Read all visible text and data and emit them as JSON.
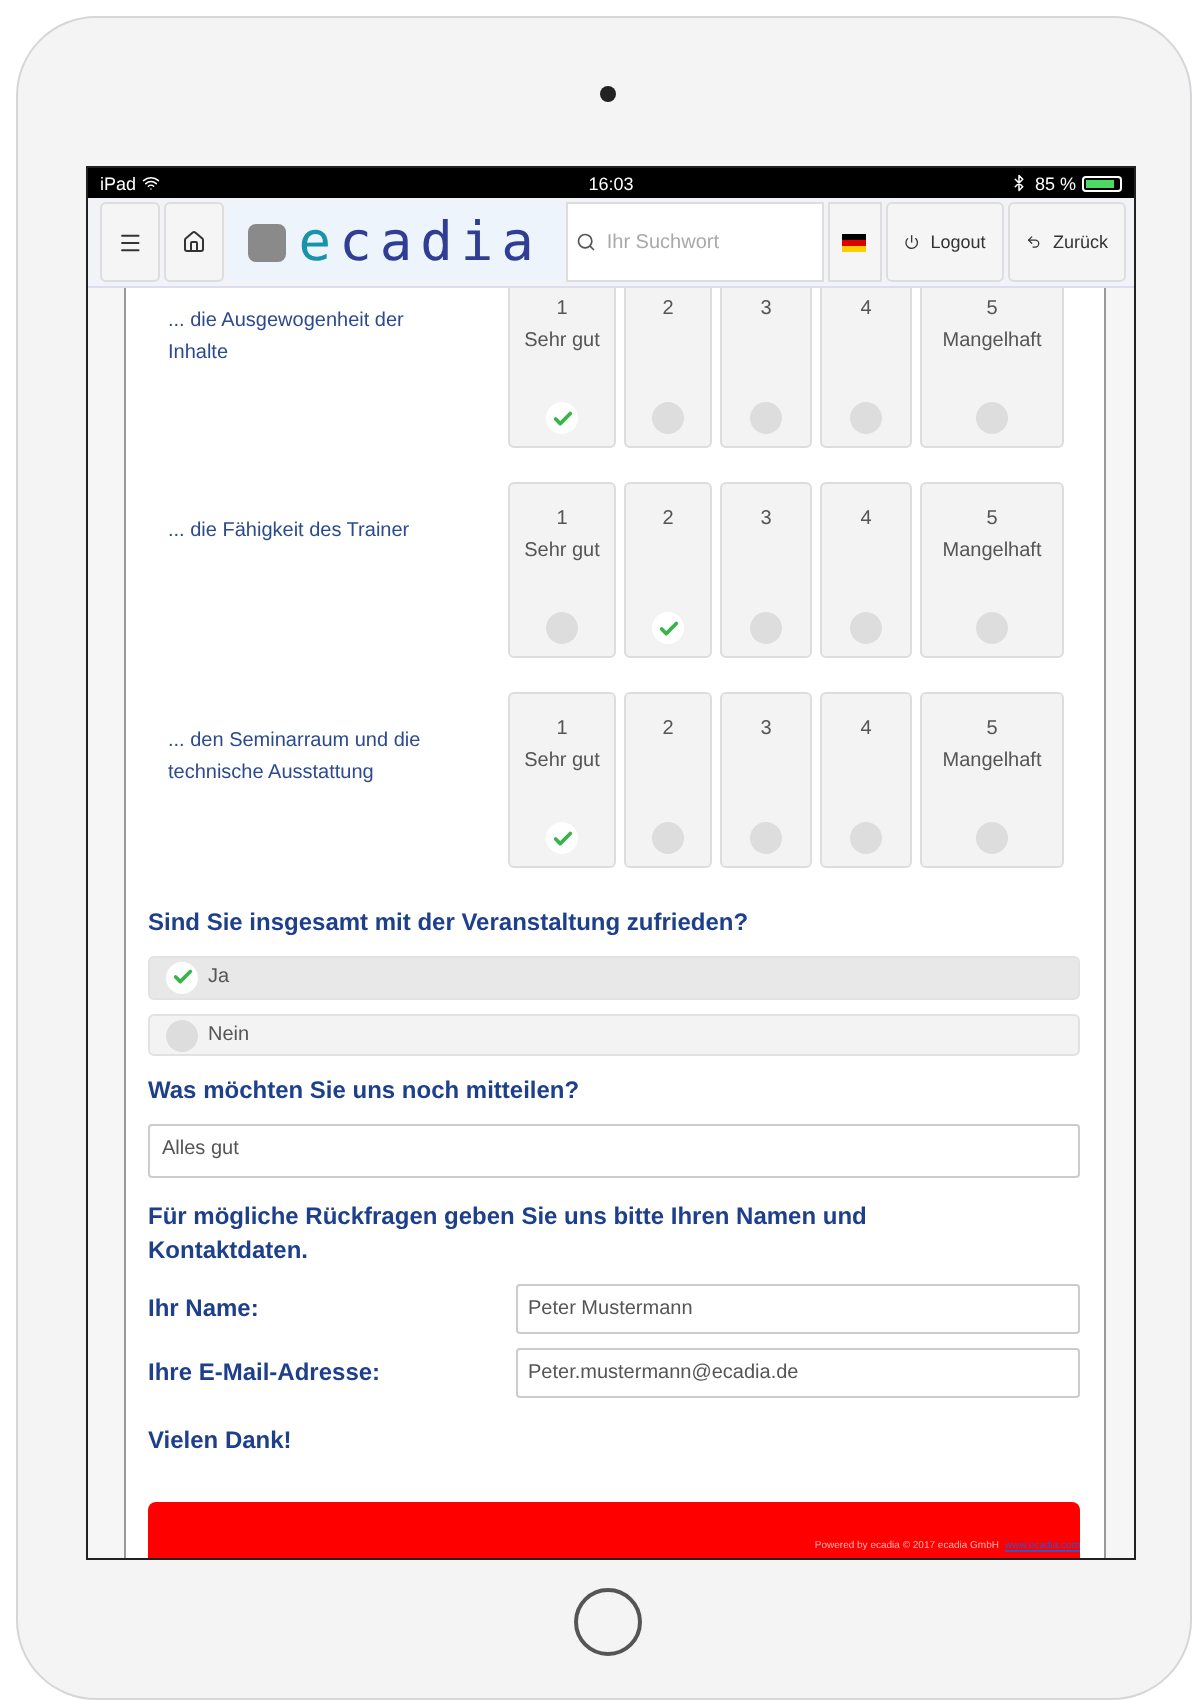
{
  "status_bar": {
    "device": "iPad",
    "time": "16:03",
    "battery": "85 %"
  },
  "header": {
    "logo": "ecadia",
    "search": {
      "placeholder": "Ihr Suchwort"
    },
    "buttons": [
      {
        "kind": "logout",
        "label": "Logout"
      },
      {
        "kind": "back",
        "label": "Zurück"
      }
    ]
  },
  "ratings": [
    {
      "label": "... die Ausgewogenheit der Inhalte",
      "options": [
        {
          "number": "1",
          "caption": "Sehr gut",
          "selected": true
        },
        {
          "number": "2",
          "selected": false
        },
        {
          "number": "3",
          "selected": false
        },
        {
          "number": "4",
          "selected": false
        },
        {
          "number": "5",
          "caption": "Mangelhaft",
          "selected": false
        }
      ]
    },
    {
      "label": "... die Fähigkeit des Trainer",
      "options": [
        {
          "number": "1",
          "caption": "Sehr gut",
          "selected": false
        },
        {
          "number": "2",
          "selected": true
        },
        {
          "number": "3",
          "selected": false
        },
        {
          "number": "4",
          "selected": false
        },
        {
          "number": "5",
          "caption": "Mangelhaft",
          "selected": false
        }
      ]
    },
    {
      "label": "... den Seminarraum und die technische Ausstattung",
      "options": [
        {
          "number": "1",
          "caption": "Sehr gut",
          "selected": true
        },
        {
          "number": "2",
          "selected": false
        },
        {
          "number": "3",
          "selected": false
        },
        {
          "number": "4",
          "selected": false
        },
        {
          "number": "5",
          "caption": "Mangelhaft",
          "selected": false
        }
      ]
    }
  ],
  "overall": {
    "question": "Sind Sie insgesamt mit der Veranstaltung zufrieden?",
    "options": [
      {
        "label": "Ja",
        "selected": true
      },
      {
        "label": "Nein",
        "selected": false
      }
    ]
  },
  "message": {
    "question": "Was möchten Sie uns noch mitteilen?",
    "value": "Alles gut"
  },
  "contact": {
    "intro": "Für mögliche Rückfragen geben Sie uns bitte Ihren Namen und Kontaktdaten.",
    "fields": [
      {
        "label": "Ihr Name:",
        "value": "Peter Mustermann"
      },
      {
        "label": "Ihre E-Mail-Adresse:",
        "value": "Peter.mustermann@ecadia.de"
      }
    ]
  },
  "thanks": "Vielen Dank!",
  "footer": {
    "text": "Powered by ecadia © 2017 ecadia GmbH",
    "link": "www.ecadia.com"
  }
}
